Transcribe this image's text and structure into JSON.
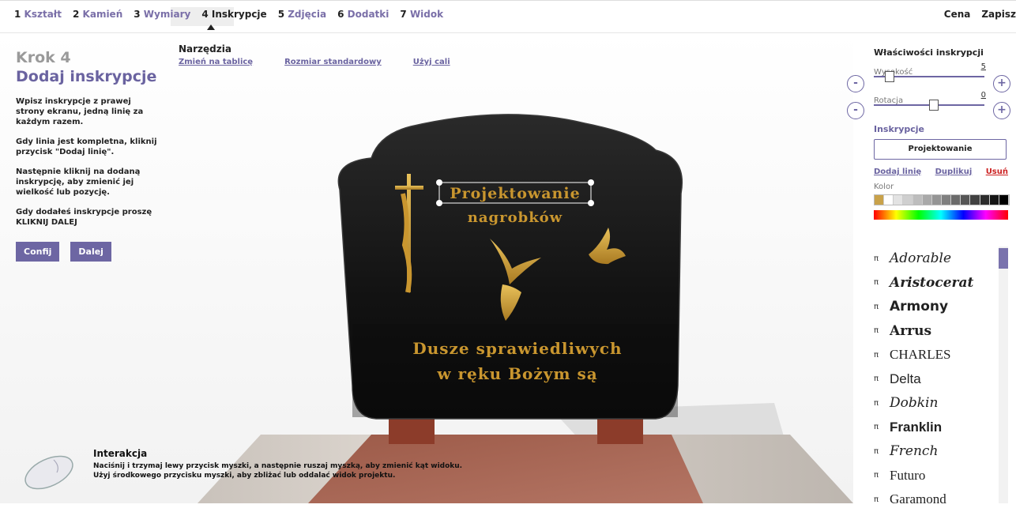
{
  "nav": {
    "steps": [
      {
        "num": "1",
        "label": "Kształt"
      },
      {
        "num": "2",
        "label": "Kamień"
      },
      {
        "num": "3",
        "label": "Wymiary"
      },
      {
        "num": "4",
        "label": "Inskrypcje"
      },
      {
        "num": "5",
        "label": "Zdjęcia"
      },
      {
        "num": "6",
        "label": "Dodatki"
      },
      {
        "num": "7",
        "label": "Widok"
      }
    ],
    "active_step": "4",
    "price_label": "Cena",
    "save_label": "Zapisz"
  },
  "left": {
    "step_title": "Krok 4",
    "step_heading": "Dodaj inskrypcje",
    "para1": "Wpisz inskrypcje z prawej strony ekranu, jedną linię za każdym razem.",
    "para2": "Gdy linia jest kompletna, kliknij przycisk \"Dodaj linię\".",
    "para3": "Następnie kliknij na dodaną inskrypcję, aby zmienić jej wielkość lub pozycję.",
    "para4": "Gdy dodałeś inskrypcje proszę KLIKNIJ DALEJ",
    "confirm_button": "Confij",
    "next_button": "Dalej"
  },
  "tools": {
    "title": "Narzędzia",
    "links": [
      "Zmień na tablicę",
      "Rozmiar standardowy",
      "Użyj cali"
    ]
  },
  "canvas": {
    "line1": "Projektowanie",
    "line2": "nagrobków",
    "epitaph1": "Dusze sprawiedliwych",
    "epitaph2": "w ręku Bożym są"
  },
  "hint": {
    "title": "Interakcja",
    "line1": "Naciśnij i trzymaj lewy przycisk myszki, a następnie ruszaj myszką, aby zmienić kąt widoku.",
    "line2": "Użyj środkowego przycisku myszki, aby zbliżać lub oddalać widok projektu."
  },
  "properties": {
    "title": "Właściwości inskrypcji",
    "height_label": "Wysokość",
    "height_value": "5",
    "height_level": 0.1,
    "rotation_label": "Rotacja",
    "rotation_value": "0",
    "rotation_level": 0.5,
    "minus": "-",
    "plus": "+",
    "inscriptions_label": "Inskrypcje",
    "inscription_value": "Projektowanie",
    "add_line": "Dodaj linię",
    "duplicate": "Duplikuj",
    "remove": "Usuń",
    "color_label": "Kolor",
    "swatches": [
      "#c9a24a",
      "#ffffff",
      "#e3e3e3",
      "#cfcfcf",
      "#bdbdbd",
      "#a9a9a9",
      "#959595",
      "#808080",
      "#6b6b6b",
      "#565656",
      "#414141",
      "#2c2c2c",
      "#151515",
      "#000000"
    ]
  },
  "fonts": [
    {
      "name": "Adorable",
      "family": "\"DejaVu Serif\", serif",
      "style": "italic",
      "weight": "normal"
    },
    {
      "name": "Aristocerat",
      "family": "\"DejaVu Serif\", serif",
      "style": "italic",
      "weight": "bold"
    },
    {
      "name": "Armony",
      "family": "\"DejaVu Sans\", sans-serif",
      "style": "normal",
      "weight": "bold"
    },
    {
      "name": "Arrus",
      "family": "\"DejaVu Serif\", serif",
      "style": "normal",
      "weight": "bold"
    },
    {
      "name": "CHARLES",
      "family": "\"Liberation Serif\", serif",
      "style": "normal",
      "weight": "normal"
    },
    {
      "name": "Delta",
      "family": "\"Liberation Sans\", sans-serif",
      "style": "normal",
      "weight": "normal"
    },
    {
      "name": "Dobkin",
      "family": "\"DejaVu Serif\", serif",
      "style": "italic",
      "weight": "normal"
    },
    {
      "name": "Franklin",
      "family": "\"Liberation Sans\", sans-serif",
      "style": "normal",
      "weight": "bold"
    },
    {
      "name": "French",
      "family": "\"DejaVu Serif\", serif",
      "style": "italic",
      "weight": "normal"
    },
    {
      "name": "Futuro",
      "family": "\"Liberation Serif\", serif",
      "style": "normal",
      "weight": "normal"
    },
    {
      "name": "Garamond",
      "family": "\"Liberation Serif\", serif",
      "style": "normal",
      "weight": "normal"
    }
  ],
  "colors": {
    "accent": "#6d66a3",
    "gold": "#c9962f",
    "stone": "#151515",
    "danger": "#cc2222"
  }
}
